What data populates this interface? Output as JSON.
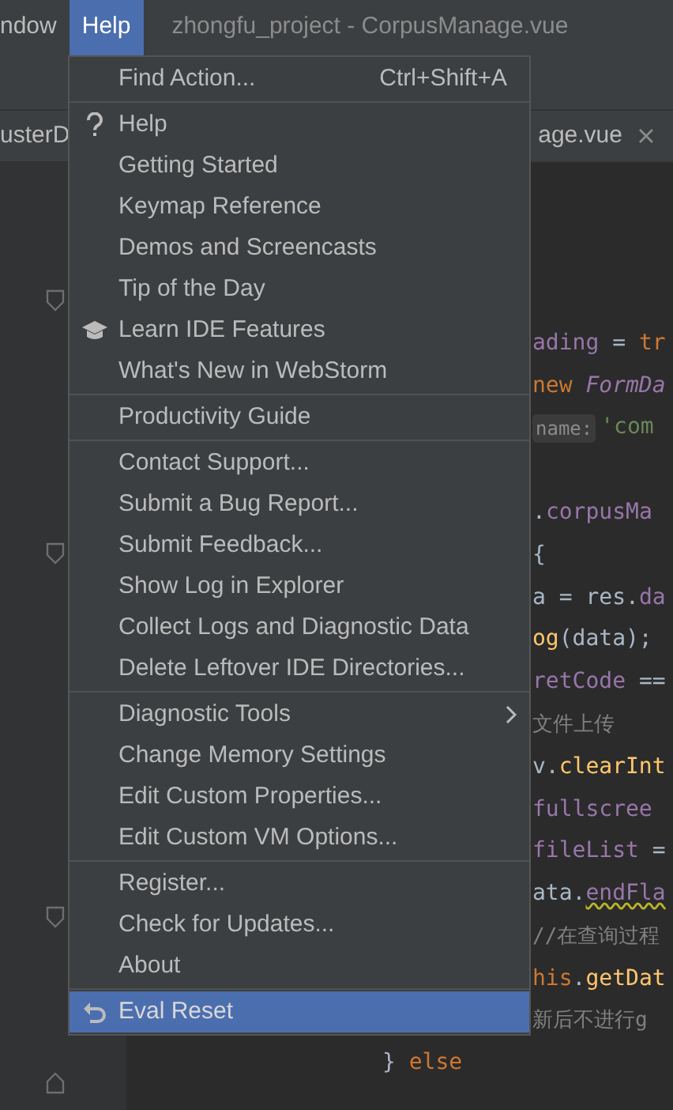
{
  "menu_bar": {
    "items": [
      {
        "label": "ndow",
        "selected": false
      },
      {
        "label": "Help",
        "selected": true
      }
    ]
  },
  "window": {
    "title": "zhongfu_project - CorpusManage.vue"
  },
  "tabs": [
    {
      "label": "usterD",
      "closable": false
    },
    {
      "label": "age.vue",
      "closable": true
    }
  ],
  "editor": {
    "lines": [
      {
        "kind": "clipped",
        "tokens": [
          {
            "text": "ading",
            "kind": "field"
          },
          {
            "text": " = ",
            "kind": "plain"
          },
          {
            "text": "tr",
            "kind": "keyword"
          }
        ]
      },
      {
        "kind": "clipped",
        "tokens": [
          {
            "text": "new ",
            "kind": "keyword"
          },
          {
            "text": "FormDa",
            "kind": "class"
          }
        ]
      },
      {
        "kind": "clipped",
        "tokens": [
          {
            "text": "name:",
            "kind": "hint"
          },
          {
            "text": "'com",
            "kind": "string"
          }
        ]
      },
      {
        "kind": "clipped"
      },
      {
        "kind": "clipped",
        "tokens": [
          {
            "text": ".",
            "kind": "plain"
          },
          {
            "text": "corpusMa",
            "kind": "field"
          }
        ]
      },
      {
        "kind": "clipped",
        "tokens": [
          {
            "text": "{",
            "kind": "plain"
          }
        ]
      },
      {
        "kind": "clipped",
        "tokens": [
          {
            "text": "a = res.",
            "kind": "plain"
          },
          {
            "text": "da",
            "kind": "field"
          }
        ]
      },
      {
        "kind": "clipped",
        "tokens": [
          {
            "text": "og",
            "kind": "func"
          },
          {
            "text": "(data);",
            "kind": "plain"
          }
        ]
      },
      {
        "kind": "clipped",
        "tokens": [
          {
            "text": "retCode",
            "kind": "field"
          },
          {
            "text": " ==",
            "kind": "plain"
          }
        ]
      },
      {
        "kind": "clipped",
        "tokens": [
          {
            "text": "文件上传",
            "kind": "comment"
          }
        ]
      },
      {
        "kind": "clipped",
        "tokens": [
          {
            "text": "v.",
            "kind": "plain"
          },
          {
            "text": "clearInt",
            "kind": "func"
          }
        ]
      },
      {
        "kind": "clipped",
        "tokens": [
          {
            "text": "fullscree",
            "kind": "field"
          }
        ]
      },
      {
        "kind": "clipped",
        "tokens": [
          {
            "text": "fileList",
            "kind": "field"
          },
          {
            "text": " =",
            "kind": "plain"
          }
        ]
      },
      {
        "kind": "clipped",
        "tokens": [
          {
            "text": "ata.",
            "kind": "plain"
          },
          {
            "text": "endFla",
            "kind": "warning"
          }
        ]
      },
      {
        "kind": "clipped",
        "tokens": [
          {
            "text": "//在查询过程",
            "kind": "comment"
          }
        ]
      },
      {
        "kind": "clipped",
        "tokens": [
          {
            "text": "his",
            "kind": "keyword"
          },
          {
            "text": ".",
            "kind": "plain"
          },
          {
            "text": "getDat",
            "kind": "func"
          }
        ]
      },
      {
        "kind": "clipped",
        "tokens": [
          {
            "text": "新后不进行g",
            "kind": "comment"
          }
        ]
      },
      {
        "kind": "outer",
        "tokens": [
          {
            "text": "} ",
            "kind": "plain"
          },
          {
            "text": "else",
            "kind": "keyword"
          }
        ]
      }
    ]
  },
  "help_menu": {
    "groups": [
      {
        "items": [
          {
            "label": "Find Action...",
            "shortcut": "Ctrl+Shift+A",
            "kind": "plain",
            "selected": false
          }
        ]
      },
      {
        "items": [
          {
            "label": "Help",
            "kind": "help",
            "selected": false
          },
          {
            "label": "Getting Started",
            "kind": "plain",
            "selected": false
          },
          {
            "label": "Keymap Reference",
            "kind": "plain",
            "selected": false
          },
          {
            "label": "Demos and Screencasts",
            "kind": "plain",
            "selected": false
          },
          {
            "label": "Tip of the Day",
            "kind": "plain",
            "selected": false
          },
          {
            "label": "Learn IDE Features",
            "kind": "learn",
            "selected": false
          },
          {
            "label": "What's New in WebStorm",
            "kind": "plain",
            "selected": false
          }
        ]
      },
      {
        "items": [
          {
            "label": "Productivity Guide",
            "kind": "plain",
            "selected": false
          }
        ]
      },
      {
        "items": [
          {
            "label": "Contact Support...",
            "kind": "plain",
            "selected": false
          },
          {
            "label": "Submit a Bug Report...",
            "kind": "plain",
            "selected": false
          },
          {
            "label": "Submit Feedback...",
            "kind": "plain",
            "selected": false
          },
          {
            "label": "Show Log in Explorer",
            "kind": "plain",
            "selected": false
          },
          {
            "label": "Collect Logs and Diagnostic Data",
            "kind": "plain",
            "selected": false
          },
          {
            "label": "Delete Leftover IDE Directories...",
            "kind": "plain",
            "selected": false
          }
        ]
      },
      {
        "items": [
          {
            "label": "Diagnostic Tools",
            "kind": "submenu",
            "selected": false
          },
          {
            "label": "Change Memory Settings",
            "kind": "plain",
            "selected": false
          },
          {
            "label": "Edit Custom Properties...",
            "kind": "plain",
            "selected": false
          },
          {
            "label": "Edit Custom VM Options...",
            "kind": "plain",
            "selected": false
          }
        ]
      },
      {
        "items": [
          {
            "label": "Register...",
            "kind": "plain",
            "selected": false
          },
          {
            "label": "Check for Updates...",
            "kind": "plain",
            "selected": false
          },
          {
            "label": "About",
            "kind": "plain",
            "selected": false
          }
        ]
      },
      {
        "items": [
          {
            "label": "Eval Reset",
            "kind": "reset",
            "selected": true
          }
        ]
      }
    ]
  }
}
